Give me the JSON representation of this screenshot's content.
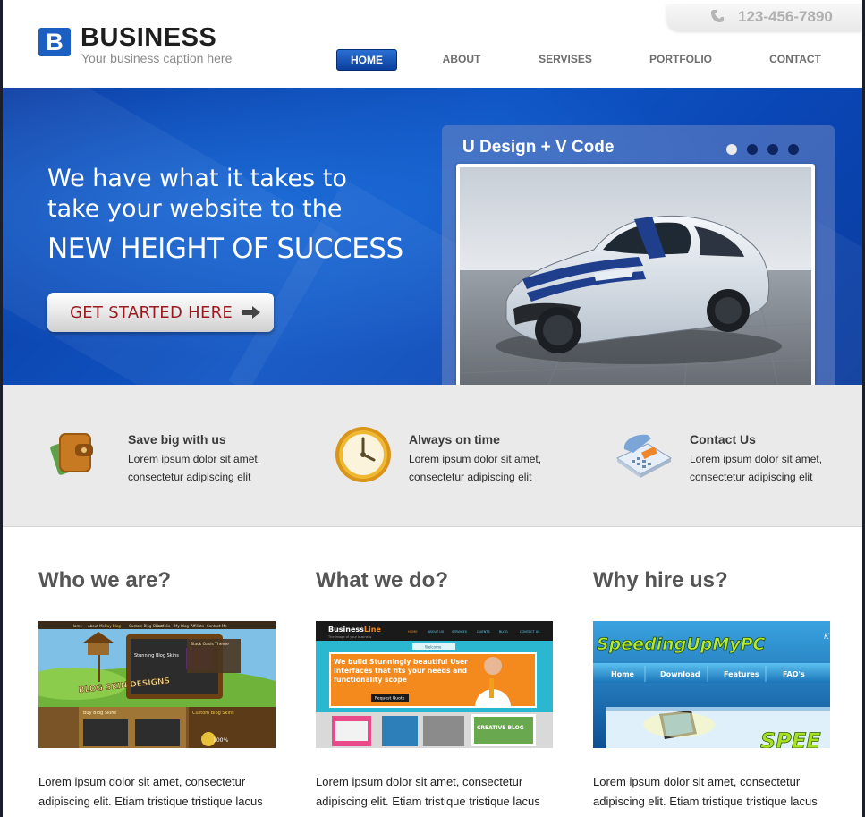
{
  "brand": {
    "logo_letter": "B",
    "title": "BUSINESS",
    "caption": "Your business caption here",
    "accent_color": "#1b5fc2"
  },
  "phone": {
    "icon": "phone-icon",
    "number": "123-456-7890"
  },
  "nav": {
    "items": [
      {
        "label": "HOME",
        "active": true
      },
      {
        "label": "ABOUT",
        "active": false
      },
      {
        "label": "SERVISES",
        "active": false
      },
      {
        "label": "PORTFOLIO",
        "active": false
      },
      {
        "label": "CONTACT",
        "active": false
      }
    ]
  },
  "hero": {
    "line1": "We have what it takes to",
    "line2": "take your website to the",
    "line3": "NEW HEIGHT OF SUCCESS",
    "cta_label": "GET STARTED HERE",
    "cta_icon": "arrow-right-icon",
    "background_color": "#0f55c4"
  },
  "slider": {
    "title": "U Design + V Code",
    "slide_count": 4,
    "active_slide": 1,
    "image": "sports-car-photo"
  },
  "features": [
    {
      "icon": "wallet-icon",
      "title": "Save big with us",
      "text_line1": "Lorem ipsum dolor sit amet,",
      "text_line2": "consectetur adipiscing elit"
    },
    {
      "icon": "clock-icon",
      "title": "Always on time",
      "text_line1": "Lorem ipsum dolor sit amet,",
      "text_line2": "consectetur adipiscing elit"
    },
    {
      "icon": "telephone-icon",
      "title": "Contact Us",
      "text_line1": "Lorem ipsum dolor sit amet,",
      "text_line2": "consectetur adipiscing elit"
    }
  ],
  "columns": [
    {
      "heading": "Who we are?",
      "thumb": {
        "kind": "blog-skins",
        "nav": [
          "Home",
          "About Me",
          "Buy Blog",
          "Custom Blog Skins",
          "Portfolio",
          "My Blog",
          "Affiliate",
          "Contact Me"
        ],
        "sign_line1": "Stunning Blog Skins",
        "banner": "BLOG SKIN DESIGNS",
        "panel_title": "Black Oasis Theme",
        "buy_label": "Buy Blog Skins",
        "custom_label": "Custom Blog Skins",
        "badge": "100%"
      },
      "text_line1": "Lorem ipsum dolor sit amet, consectetur",
      "text_line2": "adipiscing elit. Etiam tristique tristique lacus"
    },
    {
      "heading": "What we do?",
      "thumb": {
        "kind": "business-line",
        "brand_a": "Business",
        "brand_b": "Line",
        "tagline": "The image of your business",
        "nav": [
          "HOME",
          "ABOUT US",
          "SERVICES",
          "CLIENTS",
          "BLOG",
          "CONTACT US"
        ],
        "welcome": "Welcome",
        "promo": "We build Stunningly beautiful User Interfaces that fits your needs and functionality scope",
        "button": "Request Quote",
        "small_label": "CREATIVE BLOG"
      },
      "text_line1": "Lorem ipsum dolor sit amet, consectetur",
      "text_line2": "adipiscing elit. Etiam tristique tristique lacus"
    },
    {
      "heading": "Why hire us?",
      "thumb": {
        "kind": "speeding-up",
        "logo": "SpeedingUpMyPC",
        "corner": "K",
        "nav": [
          "Home",
          "Download",
          "Features",
          "FAQ's"
        ],
        "big_text": "SPEE"
      },
      "text_line1": "Lorem ipsum dolor sit amet, consectetur",
      "text_line2": "adipiscing elit. Etiam tristique tristique lacus"
    }
  ]
}
